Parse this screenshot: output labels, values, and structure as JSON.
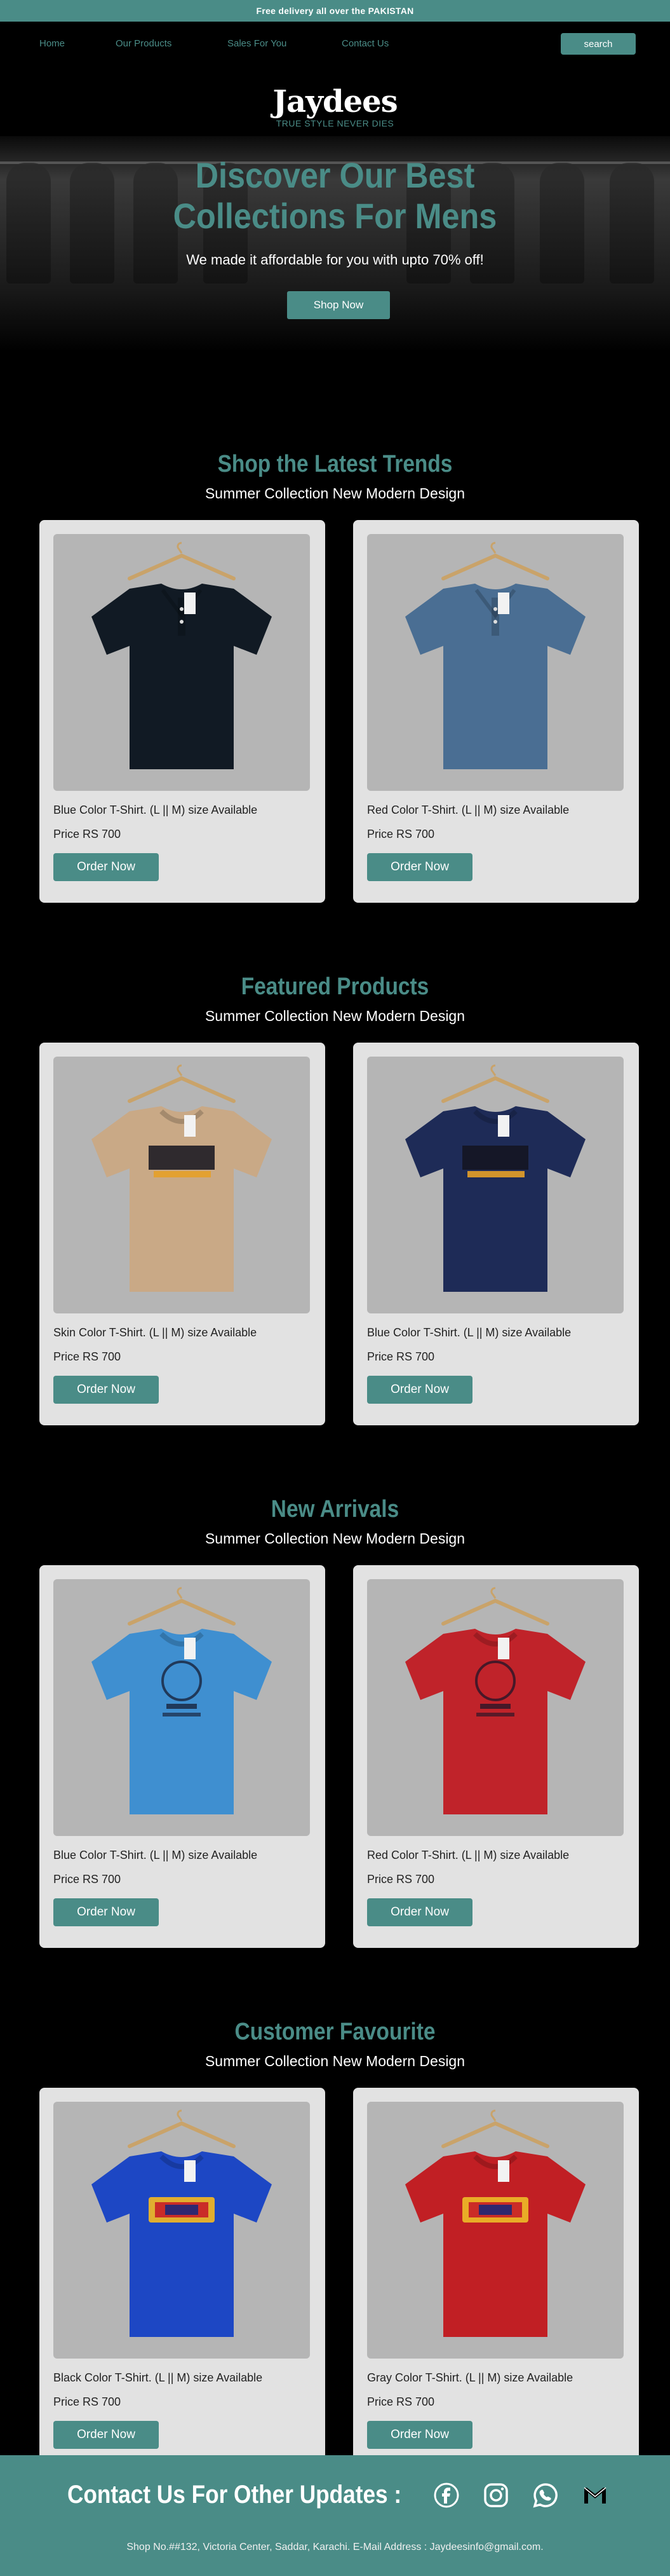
{
  "topbar": {
    "text": "Free delivery all over the PAKISTAN"
  },
  "nav": {
    "items": [
      "Home",
      "Our Products",
      "Sales For You",
      "Contact Us"
    ],
    "search_label": "search"
  },
  "hero": {
    "logo": "Jaydees",
    "tagline": "TRUE STYLE NEVER DIES",
    "title_line1": "Discover Our Best",
    "title_line2": "Collections For Mens",
    "subtitle": "We made it affordable for you with upto 70% off!",
    "button": "Shop Now"
  },
  "sections": [
    {
      "title": "Shop the Latest Trends",
      "subtitle": "Summer Collection New Modern Design",
      "products": [
        {
          "title": "Blue Color T-Shirt. (L || M) size Available",
          "price": "Price RS 700",
          "button": "Order Now",
          "shirt_color": "#111a24",
          "style": "polo"
        },
        {
          "title": "Red Color T-Shirt. (L || M) size Available",
          "price": "Price RS 700",
          "button": "Order Now",
          "shirt_color": "#4a6e93",
          "style": "polo"
        }
      ]
    },
    {
      "title": "Featured Products",
      "subtitle": "Summer Collection New Modern Design",
      "products": [
        {
          "title": "Skin Color T-Shirt. (L || M) size Available",
          "price": "Price RS 700",
          "button": "Order Now",
          "shirt_color": "#c9a986",
          "style": "never"
        },
        {
          "title": "Blue Color T-Shirt. (L || M) size Available",
          "price": "Price RS 700",
          "button": "Order Now",
          "shirt_color": "#1e2b57",
          "style": "never"
        }
      ]
    },
    {
      "title": "New Arrivals",
      "subtitle": "Summer Collection New Modern Design",
      "products": [
        {
          "title": "Blue Color T-Shirt. (L || M) size Available",
          "price": "Price RS 700",
          "button": "Order Now",
          "shirt_color": "#3f8fd0",
          "style": "print"
        },
        {
          "title": "Red Color T-Shirt. (L || M) size Available",
          "price": "Price RS 700",
          "button": "Order Now",
          "shirt_color": "#c0232a",
          "style": "print"
        }
      ]
    },
    {
      "title": "Customer Favourite",
      "subtitle": "Summer Collection New Modern Design",
      "products": [
        {
          "title": "Black Color T-Shirt. (L || M) size Available",
          "price": "Price RS 700",
          "button": "Order Now",
          "shirt_color": "#1d47c4",
          "style": "fila"
        },
        {
          "title": "Gray Color T-Shirt. (L || M) size Available",
          "price": "Price RS 700",
          "button": "Order Now",
          "shirt_color": "#c11f24",
          "style": "fila"
        }
      ]
    }
  ],
  "footer": {
    "title": "Contact Us For Other Updates :",
    "address": "Shop No.##132, Victoria Center, Saddar, Karachi. E-Mail Address : Jaydeesinfo@gmail.com.",
    "social_icons": [
      "facebook-icon",
      "instagram-icon",
      "whatsapp-icon",
      "gmail-icon"
    ]
  },
  "colors": {
    "accent": "#4a8c87",
    "background": "#000000",
    "card": "#e2e2e2",
    "image_bg": "#b5b5b5"
  }
}
